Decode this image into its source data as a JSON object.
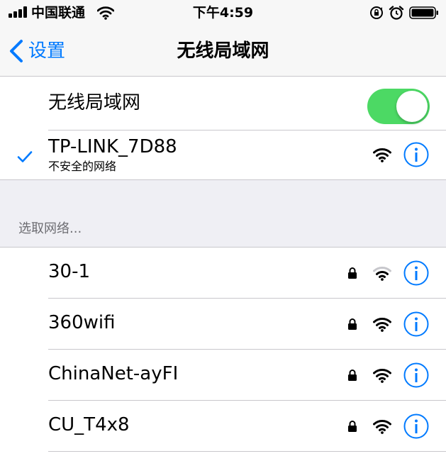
{
  "status_bar": {
    "carrier": "中国联通",
    "time": "下午4:59"
  },
  "nav": {
    "back_label": "设置",
    "title": "无线局域网"
  },
  "wifi_toggle": {
    "label": "无线局域网",
    "enabled": true
  },
  "connected_network": {
    "name": "TP-LINK_7D88",
    "subtitle": "不安全的网络",
    "signal": "full"
  },
  "section": {
    "header": "选取网络..."
  },
  "networks": [
    {
      "name": "30-1",
      "locked": true,
      "signal": "weak"
    },
    {
      "name": "360wifi",
      "locked": true,
      "signal": "full"
    },
    {
      "name": "ChinaNet-ayFI",
      "locked": true,
      "signal": "full"
    },
    {
      "name": "CU_T4x8",
      "locked": true,
      "signal": "full"
    }
  ],
  "colors": {
    "accent": "#007aff",
    "toggle_on": "#4cd964",
    "background": "#efeff4",
    "separator": "#c8c7cc",
    "section_text": "#6d6d72"
  },
  "icons": {
    "signal": "cellular-signal-icon",
    "wifi": "wifi-icon",
    "lock": "lock-icon",
    "info": "info-icon",
    "check": "checkmark-icon",
    "back": "chevron-left-icon",
    "rotation": "rotation-lock-icon",
    "alarm": "alarm-icon",
    "battery": "battery-icon"
  }
}
